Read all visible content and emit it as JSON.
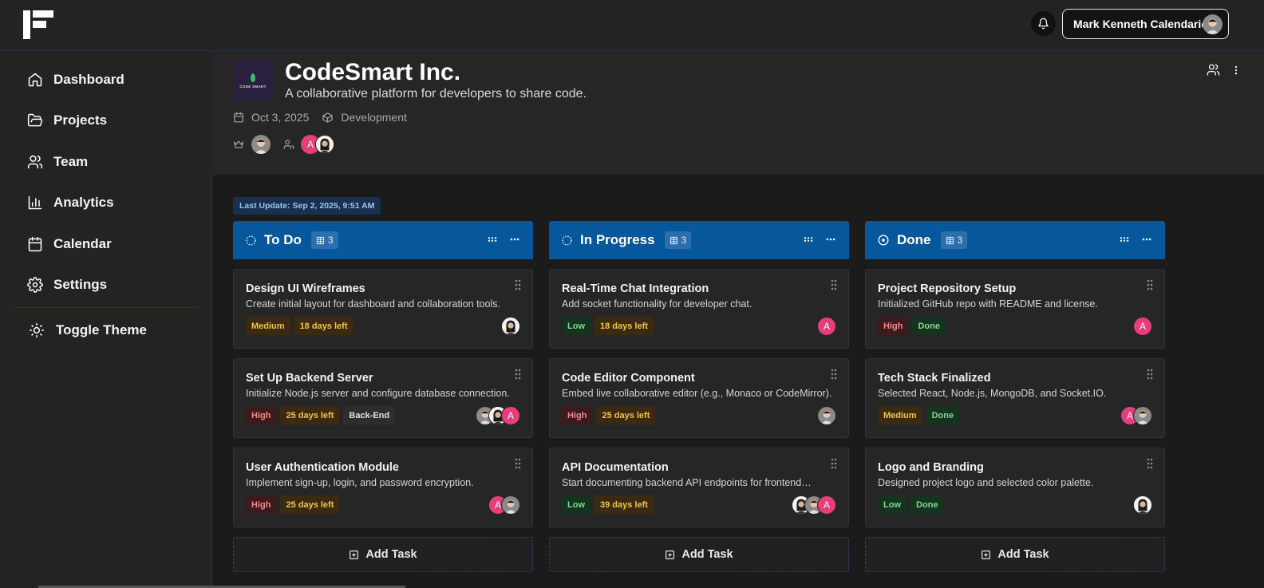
{
  "user": {
    "name": "Mark Kenneth Calendario"
  },
  "nav": [
    {
      "label": "Dashboard",
      "icon": "home-icon"
    },
    {
      "label": "Projects",
      "icon": "folder-icon"
    },
    {
      "label": "Team",
      "icon": "team-icon"
    },
    {
      "label": "Analytics",
      "icon": "chart-icon"
    },
    {
      "label": "Calendar",
      "icon": "calendar-icon"
    },
    {
      "label": "Settings",
      "icon": "gear-icon"
    }
  ],
  "toggle_theme": {
    "label": "Toggle Theme",
    "icon": "sun-icon"
  },
  "project": {
    "logo_text": "CODE SMART",
    "title": "CodeSmart Inc.",
    "description": "A collaborative platform for developers to share code.",
    "date": "Oct 3, 2025",
    "category": "Development"
  },
  "last_update": "Last Update: Sep 2, 2025, 9:51 AM",
  "add_task_label": "Add Task",
  "avatar_letter": "A",
  "columns": [
    {
      "title": "To Do",
      "count": "3",
      "icon": "dashed-circle-icon",
      "cards": [
        {
          "title": "Design UI Wireframes",
          "desc": "Create initial layout for dashboard and collaboration tools.",
          "tags": [
            [
              "Medium",
              "medium"
            ],
            [
              "18 days left",
              "days"
            ]
          ],
          "avatars": [
            "w"
          ]
        },
        {
          "title": "Set Up Backend Server",
          "desc": "Initialize Node.js server and configure database connection.",
          "tags": [
            [
              "High",
              "high"
            ],
            [
              "25 days left",
              "days"
            ],
            [
              "Back-End",
              "neutral"
            ]
          ],
          "avatars": [
            "a",
            "w",
            "m"
          ]
        },
        {
          "title": "User Authentication Module",
          "desc": "Implement sign-up, login, and password encryption.",
          "tags": [
            [
              "High",
              "high"
            ],
            [
              "25 days left",
              "days"
            ]
          ],
          "avatars": [
            "m",
            "a"
          ]
        }
      ]
    },
    {
      "title": "In Progress",
      "count": "3",
      "icon": "dashed-circle-icon",
      "cards": [
        {
          "title": "Real-Time Chat Integration",
          "desc": "Add socket functionality for developer chat.",
          "tags": [
            [
              "Low",
              "low"
            ],
            [
              "18 days left",
              "days"
            ]
          ],
          "avatars": [
            "a"
          ]
        },
        {
          "title": "Code Editor Component",
          "desc": "Embed live collaborative editor (e.g., Monaco or CodeMirror).",
          "tags": [
            [
              "High",
              "high"
            ],
            [
              "25 days left",
              "days"
            ]
          ],
          "avatars": [
            "m"
          ]
        },
        {
          "title": "API Documentation",
          "desc": "Start documenting backend API endpoints for frontend…",
          "tags": [
            [
              "Low",
              "low"
            ],
            [
              "39 days left",
              "days"
            ]
          ],
          "avatars": [
            "a",
            "m",
            "w"
          ]
        }
      ]
    },
    {
      "title": "Done",
      "count": "3",
      "icon": "check-circle-icon",
      "cards": [
        {
          "title": "Project Repository Setup",
          "desc": "Initialized GitHub repo with README and license.",
          "tags": [
            [
              "High",
              "high"
            ],
            [
              "Done",
              "done"
            ]
          ],
          "avatars": [
            "a"
          ]
        },
        {
          "title": "Tech Stack Finalized",
          "desc": "Selected React, Node.js, MongoDB, and Socket.IO.",
          "tags": [
            [
              "Medium",
              "medium"
            ],
            [
              "Done",
              "done"
            ]
          ],
          "avatars": [
            "m",
            "a"
          ]
        },
        {
          "title": "Logo and Branding",
          "desc": "Designed project logo and selected color palette.",
          "tags": [
            [
              "Low",
              "low"
            ],
            [
              "Done",
              "done"
            ]
          ],
          "avatars": [
            "w"
          ]
        }
      ]
    }
  ]
}
